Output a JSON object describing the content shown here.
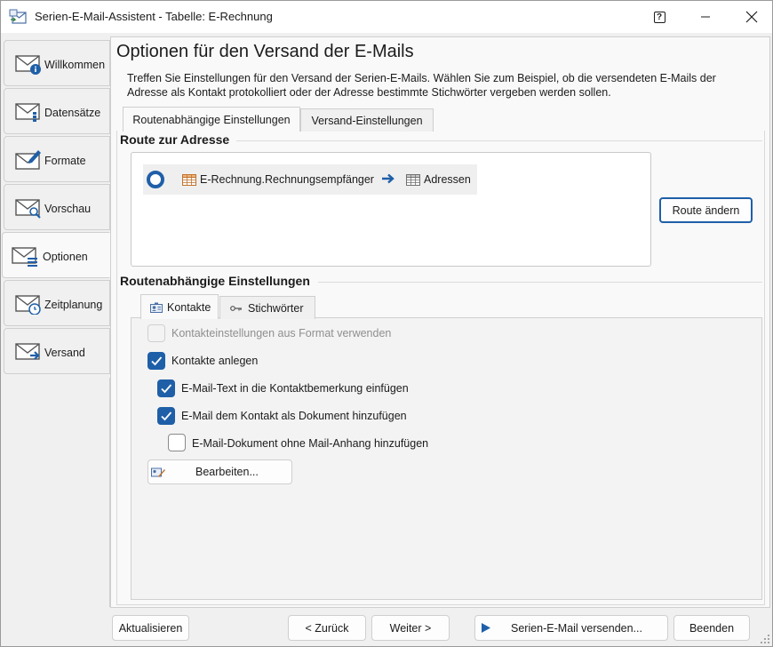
{
  "window": {
    "title": "Serien-E-Mail-Assistent - Tabelle: E-Rechnung",
    "help_glyph": "?",
    "minimize_glyph": "—",
    "maximize_glyph": "☐",
    "close_glyph": "✕"
  },
  "sidebar": {
    "items": [
      {
        "label": "Willkommen",
        "icon": "mail-info-icon"
      },
      {
        "label": "Datensätze",
        "icon": "mail-records-icon"
      },
      {
        "label": "Formate",
        "icon": "mail-edit-icon"
      },
      {
        "label": "Vorschau",
        "icon": "mail-preview-icon"
      },
      {
        "label": "Optionen",
        "icon": "mail-options-icon",
        "active": true
      },
      {
        "label": "Zeitplanung",
        "icon": "mail-clock-icon"
      },
      {
        "label": "Versand",
        "icon": "mail-send-icon"
      }
    ]
  },
  "page": {
    "title": "Optionen für den Versand der E-Mails",
    "description": "Treffen Sie Einstellungen für den Versand der Serien-E-Mails. Wählen Sie zum Beispiel, ob die versendeten E-Mails der Adresse als Kontakt protokolliert oder der Adresse bestimmte Stichwörter vergeben werden sollen."
  },
  "tabs": [
    {
      "label": "Routenabhängige Einstellungen",
      "active": true
    },
    {
      "label": "Versand-Einstellungen",
      "active": false
    }
  ],
  "route": {
    "section_title": "Route zur Adresse",
    "from": "E-Rechnung.Rechnungsempfänger",
    "to": "Adressen",
    "change_button": "Route ändern"
  },
  "route_settings": {
    "section_title": "Routenabhängige Einstellungen",
    "tabs": [
      {
        "label": "Kontakte",
        "icon": "contacts-icon",
        "active": true
      },
      {
        "label": "Stichwörter",
        "icon": "key-icon",
        "active": false
      }
    ],
    "options": [
      {
        "label": "Kontakteinstellungen aus Format verwenden",
        "checked": false,
        "disabled": true
      },
      {
        "label": "Kontakte anlegen",
        "checked": true,
        "disabled": false
      },
      {
        "label": "E-Mail-Text in die Kontaktbemerkung einfügen",
        "checked": true,
        "disabled": false
      },
      {
        "label": "E-Mail dem Kontakt als Dokument hinzufügen",
        "checked": true,
        "disabled": false
      },
      {
        "label": "E-Mail-Dokument ohne Mail-Anhang hinzufügen",
        "checked": false,
        "disabled": false
      }
    ],
    "edit_button": "Bearbeiten..."
  },
  "footer": {
    "refresh": "Aktualisieren",
    "back": "< Zurück",
    "next": "Weiter >",
    "send": "Serien-E-Mail versenden...",
    "finish": "Beenden"
  },
  "colors": {
    "accent": "#1f5fa8",
    "panel_bg": "#f9f9f9",
    "window_bg": "#f0f0f0"
  }
}
